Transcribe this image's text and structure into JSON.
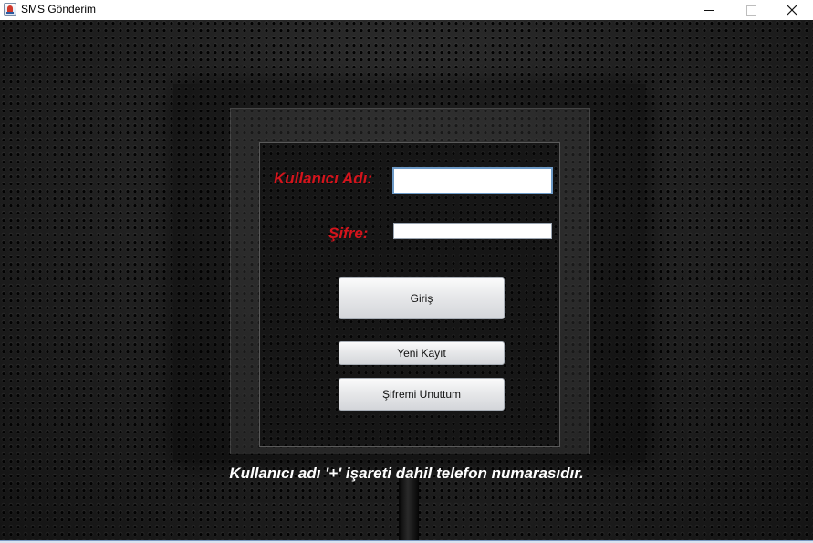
{
  "window": {
    "title": "SMS Gönderim",
    "app_icon": "java-cup-icon",
    "minimize_icon": "minimize-icon",
    "maximize_icon": "maximize-icon",
    "close_icon": "close-icon"
  },
  "form": {
    "username_label": "Kullanıcı Adı:",
    "username_value": "",
    "password_label": "Şifre:",
    "password_value": "",
    "login_button": "Giriş",
    "register_button": "Yeni Kayıt",
    "forgot_button": "Şifremi Unuttum"
  },
  "hint_text": "Kullanıcı adı '+' işareti dahil telefon numarasıdır.",
  "colors": {
    "label_red": "#d4141c",
    "hint_white": "#ffffff",
    "focus_blue": "#6d9ac7"
  }
}
